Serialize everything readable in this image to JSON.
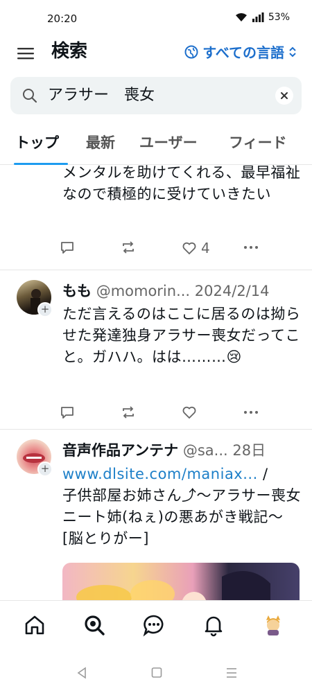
{
  "status": {
    "time": "20:20",
    "battery": "53%"
  },
  "header": {
    "title": "検索",
    "language_label": "すべての言語"
  },
  "search": {
    "query": "アラサー　喪女"
  },
  "tabs": [
    {
      "label": "トップ"
    },
    {
      "label": "最新"
    },
    {
      "label": "ユーザー"
    },
    {
      "label": "フィード"
    }
  ],
  "posts": [
    {
      "text": "メンタルを助けてくれる、最早福祉なので積極的に受けていきたい",
      "likes": "4"
    },
    {
      "name": "もも",
      "handle": "@momorin...",
      "date": "2024/2/14",
      "text": "ただ言えるのはここに居るのは拗らせた発達独身アラサー喪女だってこと。ガハハ。はは………😢"
    },
    {
      "name": "音声作品アンテナ",
      "handle": "@sa...",
      "date": "28日",
      "link": "www.dlsite.com/maniax...",
      "after_link": " /",
      "text": "子供部屋お姉さん⤴〜アラサー喪女ニート姉(ねぇ)の悪あがき戦記〜 [脳とりがー]"
    }
  ],
  "icons": {
    "menu": "hamburger-icon",
    "globe": "globe-icon",
    "search": "search-icon",
    "clear": "close-icon",
    "reply": "reply-icon",
    "repost": "repost-icon",
    "like": "heart-icon",
    "more": "more-icon",
    "nav": [
      "home-icon",
      "search-icon",
      "chat-icon",
      "bell-icon",
      "profile-avatar"
    ]
  },
  "colors": {
    "accent": "#1d9bf0",
    "link": "#1d7fc8",
    "lang": "#1d6fcc"
  }
}
